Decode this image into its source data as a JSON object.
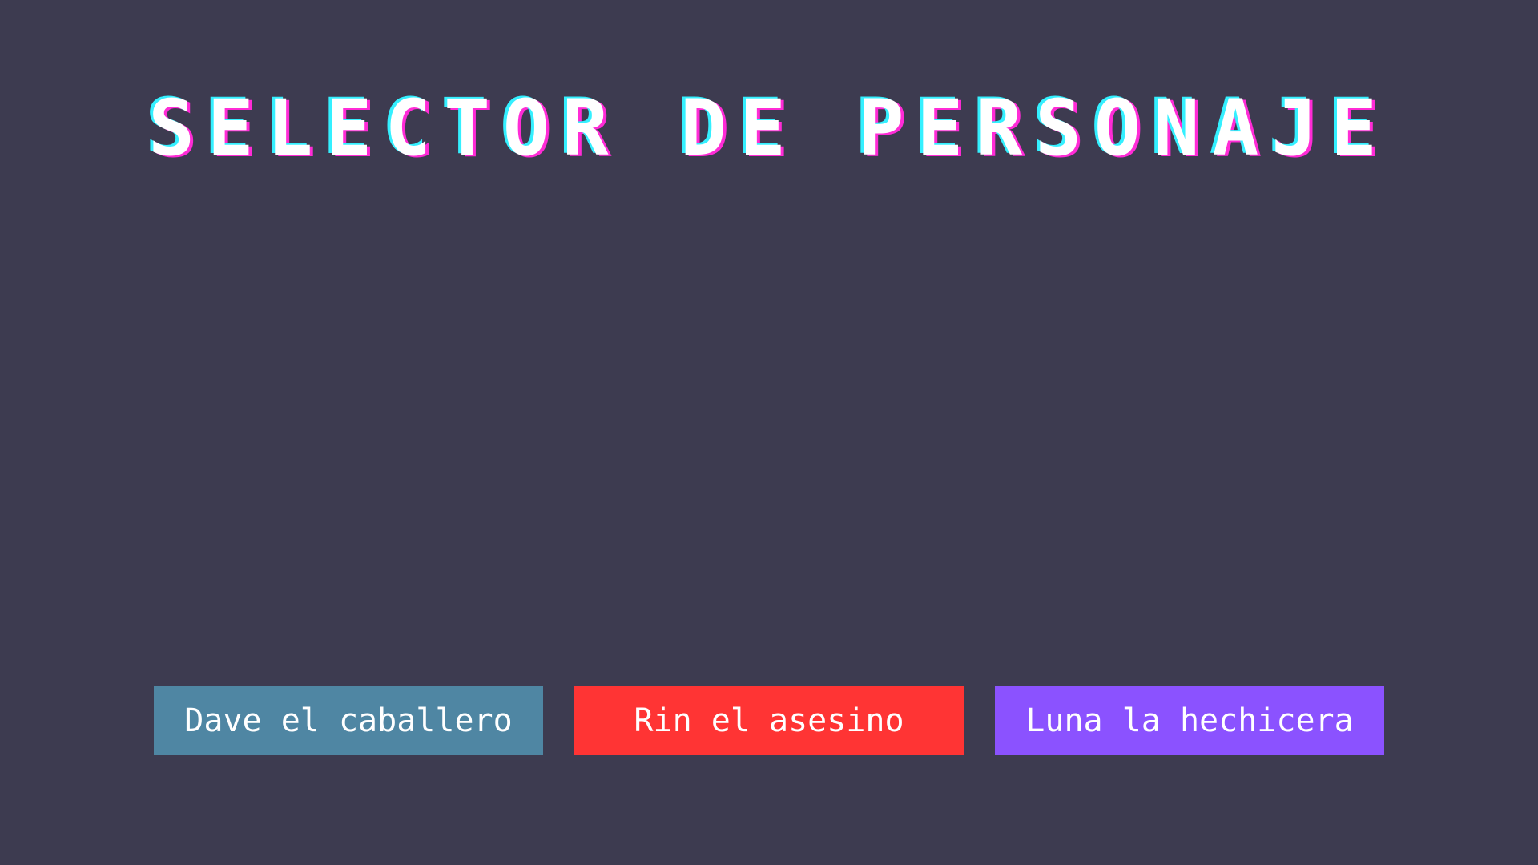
{
  "title": "SELECTOR DE PERSONAJE",
  "colors": {
    "background": "#3d3b50",
    "title_text": "#ffffff",
    "title_shadow_cyan": "#34f0ff",
    "title_shadow_magenta": "#ff2bd6"
  },
  "characters": [
    {
      "label": "Dave el caballero",
      "color": "#4f86a3"
    },
    {
      "label": "Rin el asesino",
      "color": "#ff3434"
    },
    {
      "label": "Luna la hechicera",
      "color": "#8b52ff"
    }
  ]
}
